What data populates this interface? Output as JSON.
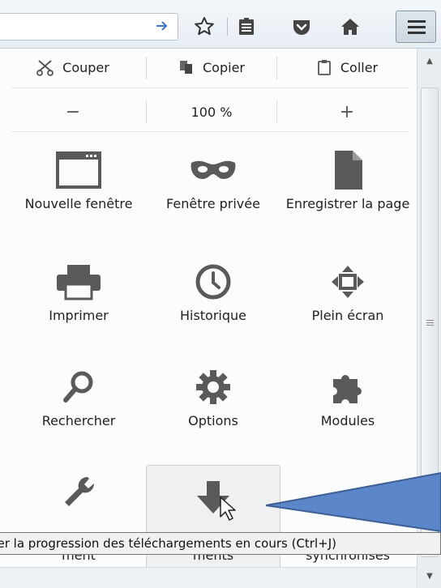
{
  "toolbar": {
    "icons": [
      "go-arrow-icon",
      "star-bookmark-icon",
      "reading-list-icon",
      "pocket-icon",
      "home-icon",
      "hamburger-menu-icon"
    ]
  },
  "edit": {
    "cut": "Couper",
    "copy": "Copier",
    "paste": "Coller"
  },
  "zoom": {
    "minus": "−",
    "level": "100 %",
    "plus": "+"
  },
  "grid": [
    {
      "label": "Nouvelle fenêtre",
      "icon": "new-window-icon"
    },
    {
      "label": "Fenêtre privée",
      "icon": "private-mask-icon"
    },
    {
      "label": "Enregistrer la page",
      "icon": "save-page-icon"
    },
    {
      "label": "Imprimer",
      "icon": "printer-icon"
    },
    {
      "label": "Historique",
      "icon": "history-clock-icon"
    },
    {
      "label": "Plein écran",
      "icon": "fullscreen-icon"
    },
    {
      "label": "Rechercher",
      "icon": "search-icon"
    },
    {
      "label": "Options",
      "icon": "gear-icon"
    },
    {
      "label": "Modules",
      "icon": "puzzle-icon"
    }
  ],
  "bottom_row": {
    "left": "ment",
    "middle": "ments",
    "right": "synchronisés"
  },
  "tooltip": "ner la progression des téléchargements en cours (Ctrl+J)",
  "colors": {
    "icon": "#5a5a5a",
    "accent_blue": "#3b78c9",
    "callout_fill": "#5b86c9"
  }
}
